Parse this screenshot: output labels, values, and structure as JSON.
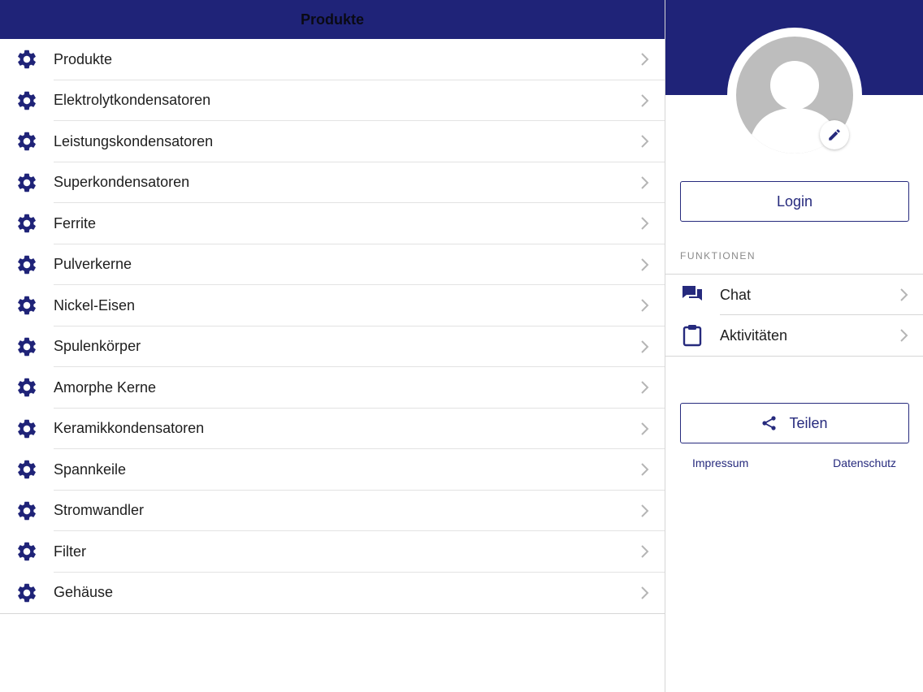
{
  "header": {
    "title": "Produkte"
  },
  "colors": {
    "brand": "#1f2378",
    "accent": "#262a7d",
    "avatar": "#bdbdbd"
  },
  "products": {
    "icon": "gear-icon",
    "items": [
      {
        "label": "Produkte"
      },
      {
        "label": "Elektrolytkondensatoren"
      },
      {
        "label": "Leistungskondensatoren"
      },
      {
        "label": "Superkondensatoren"
      },
      {
        "label": "Ferrite"
      },
      {
        "label": "Pulverkerne"
      },
      {
        "label": "Nickel-Eisen"
      },
      {
        "label": "Spulenkörper"
      },
      {
        "label": "Amorphe Kerne"
      },
      {
        "label": "Keramikkondensatoren"
      },
      {
        "label": "Spannkeile"
      },
      {
        "label": "Stromwandler"
      },
      {
        "label": "Filter"
      },
      {
        "label": "Gehäuse"
      }
    ]
  },
  "profile": {
    "avatar_icon": "user-avatar-icon",
    "edit_icon": "pencil-icon",
    "login_label": "Login"
  },
  "functions": {
    "section_title": "FUNKTIONEN",
    "items": [
      {
        "label": "Chat",
        "icon": "chat-icon"
      },
      {
        "label": "Aktivitäten",
        "icon": "clipboard-icon"
      }
    ]
  },
  "share": {
    "label": "Teilen",
    "icon": "share-icon"
  },
  "footer": {
    "impressum": "Impressum",
    "datenschutz": "Datenschutz"
  }
}
